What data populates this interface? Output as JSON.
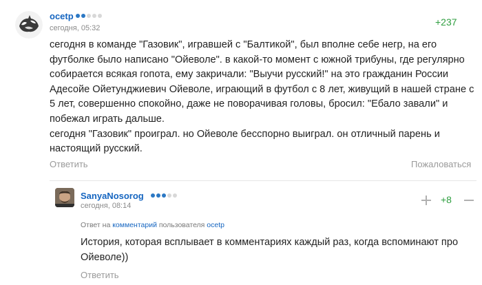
{
  "comments": [
    {
      "username": "ocetp",
      "rank_dots": {
        "filled": 2,
        "total": 5
      },
      "timestamp": "сегодня, 05:32",
      "rating": "+237",
      "text": "сегодня в команде \"Газовик\", игравшей с \"Балтикой\", был вполне себе негр, на его футболке было написано \"Ойеволе\". в какой-то момент с южной трибуны, где регулярно собирается всякая гопота, ему закричали: \"Выучи русский!\" на это гражданин России Адесойе Ойетунджиевич Ойеволе, играющий в футбол с 8 лет, живущий в нашей стране с 5 лет, совершенно спокойно, даже не поворачивая головы, бросил: \"Ебало завали\" и побежал играть дальше.\nсегодня \"Газовик\" проиграл. но Ойеволе бесспорно выиграл. он отличный парень и настоящий русский.",
      "reply_label": "Ответить",
      "report_label": "Пожаловаться"
    },
    {
      "username": "SanyaNosorog",
      "rank_dots": {
        "filled": 3,
        "total": 5
      },
      "timestamp": "сегодня, 08:14",
      "rating": "+8",
      "reply_to": {
        "prefix": "Ответ на",
        "link": "комментарий",
        "middle": "пользователя",
        "user": "ocetp"
      },
      "text": "История, которая всплывает в комментариях каждый раз, когда вспоминают про Ойеволе))",
      "reply_label": "Ответить"
    }
  ],
  "colors": {
    "username": "#1565c0",
    "rating": "#2e9e3f",
    "muted": "#9a9a9a",
    "dot_on": "#2b78c4",
    "dot_off": "#d8d8d8"
  }
}
